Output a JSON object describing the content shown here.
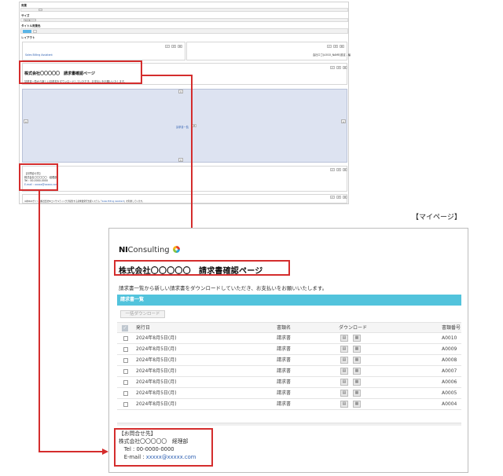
{
  "editor": {
    "labels": {
      "background": "背景",
      "size": "サイズ",
      "title_size": "タイトル背景色",
      "layout": "レイアウト"
    },
    "size_value": "1 / 1",
    "swatch_color": "#5ab4e6",
    "header_left_link": "Sales Billing Assistant",
    "header_right_text": "会社ロゴ(LOGO_NAME)設定 - 編",
    "title": "株式会社〇〇〇〇〇　請求書確認ページ",
    "desc": "請求書一覧から新しい請求書をダウンロードしていただき、お支払いをお願いいたします。",
    "canvas_label": "請求書一覧",
    "contact_lines": [
      "【お問合せ先】",
      "株式会社〇〇〇〇〇　経理部",
      "Tel : 00-0000-0000"
    ],
    "contact_mail": "E-mail : xxxxx@xxxxx.com",
    "footer_prefix": "※本Webサイトは株式会社NIコンサルティングが提供する請求書発行支援システム「",
    "footer_link": "Sales Billing Assistant",
    "footer_suffix": "」を利用しています。",
    "panel_buttons": [
      "✓",
      "↺",
      "⚙"
    ]
  },
  "mypage": {
    "caption": "【マイページ】",
    "logo_bold": "NI",
    "logo_rest": "Consulting",
    "title": "株式会社〇〇〇〇〇　請求書確認ページ",
    "desc": "請求書一覧から新しい請求書をダウンロードしていただき、お支払いをお願いいたします。",
    "list_header": "請求書一覧",
    "bulk_download": "一括ダウンロード",
    "columns": {
      "check": "✓",
      "date": "発行日",
      "name": "書類名",
      "download": "ダウンロード",
      "number": "書類番号"
    },
    "rows": [
      {
        "date": "2024年8月5日(月)",
        "name": "請求書",
        "number": "A0010"
      },
      {
        "date": "2024年8月5日(月)",
        "name": "請求書",
        "number": "A0009"
      },
      {
        "date": "2024年8月5日(月)",
        "name": "請求書",
        "number": "A0008"
      },
      {
        "date": "2024年8月5日(月)",
        "name": "請求書",
        "number": "A0007"
      },
      {
        "date": "2024年8月5日(月)",
        "name": "請求書",
        "number": "A0006"
      },
      {
        "date": "2024年8月5日(月)",
        "name": "請求書",
        "number": "A0005"
      },
      {
        "date": "2024年8月5日(月)",
        "name": "請求書",
        "number": "A0004"
      }
    ],
    "contact_lines": [
      "【お問合せ先】",
      "株式会社〇〇〇〇〇　経理部",
      "　Tel : 00-0000-0000"
    ],
    "contact_mail_label": "　E-mail : ",
    "contact_mail": "xxxxx@xxxxx.com"
  },
  "colors": {
    "accent": "#52c3dc",
    "callout": "#d42d2d",
    "link": "#2a5db0"
  }
}
